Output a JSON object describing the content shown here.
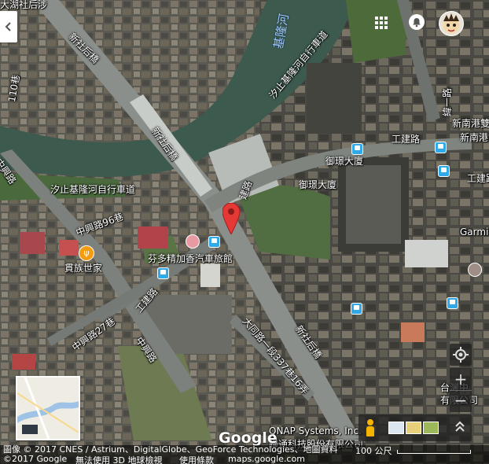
{
  "river_label": "基隆河",
  "road_labels": {
    "xinshe_bridge_top": "新社后橋",
    "xinshe_bridge_mid": "新社后橋",
    "xinshe_bridge_low": "新社后橋",
    "lane110": "110巷",
    "zhongxing_left": "中興路",
    "zhongxing_96": "中興路96巷",
    "zhongxing_27": "中興路27巷",
    "zhongxing_bottom": "中興路",
    "gongjian_right": "工建路",
    "gongjian_right2": "工建路",
    "gongjian_mid": "建路",
    "gongjian_left": "工建路",
    "bike_path_left": "汐止基隆河自行車道",
    "bike_path_right": "汐止基隆河自行車道",
    "kangning_top": "大同路一段",
    "weiyi_road": "緯一路",
    "datong_lane": "大同路一段337巷16弄",
    "xinshe_bridge_right": "新社后橋",
    "top_left_lane": "大湖社后涉"
  },
  "places": {
    "yuken": "御璟大廈",
    "yuken2": "御璟大廈",
    "restaurant": "貫族世家",
    "hotel": "芬多精加香汽車旅館",
    "qnap_en": "QNAP Systems, Inc.",
    "qnap_zh": "聯通科技股份有限公司",
    "garmin": "Garmi",
    "xinnangang1": "新南港雙",
    "xinnangang2": "新南港雙",
    "taiwan": "台灣中",
    "taiwan2": "有限公司"
  },
  "footer": {
    "imagery": "圖像 © 2017 CNES / Astrium、DigitalGlobe、GeoForce Technologies、地圖資料",
    "copyright": "©2017 Google",
    "no_3d": "無法使用 3D 地球檢視",
    "terms": "使用條款",
    "site": "maps.google.com",
    "scale": "100 公尺"
  },
  "google_logo": "Google",
  "colors": {
    "river": "#3c5a4e",
    "road": "#8b8f8b",
    "pin": "#e53935",
    "poi_blue": "#31a9e6"
  }
}
